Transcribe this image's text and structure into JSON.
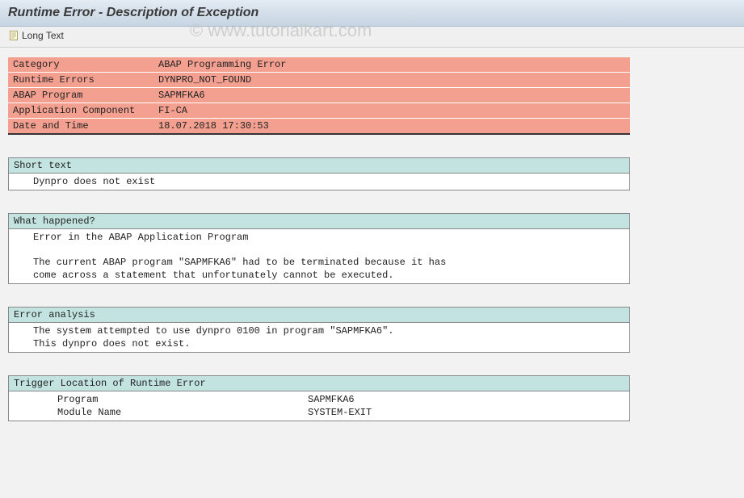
{
  "page_title": "Runtime Error - Description of Exception",
  "toolbar": {
    "long_text_label": "Long Text"
  },
  "info": {
    "rows": [
      {
        "label": "Category",
        "value": "ABAP Programming Error"
      },
      {
        "label": "Runtime Errors",
        "value": "DYNPRO_NOT_FOUND"
      },
      {
        "label": "ABAP Program",
        "value": "SAPMFKA6"
      },
      {
        "label": "Application Component",
        "value": "FI-CA"
      },
      {
        "label": "Date and Time",
        "value": "18.07.2018 17:30:53"
      }
    ]
  },
  "sections": {
    "short_text": {
      "header": "Short text",
      "lines": [
        "Dynpro does not exist"
      ]
    },
    "what_happened": {
      "header": "What happened?",
      "lines": [
        "Error in the ABAP Application Program",
        "",
        "The current ABAP program \"SAPMFKA6\" had to be terminated because it has",
        "come across a statement that unfortunately cannot be executed."
      ]
    },
    "error_analysis": {
      "header": "Error analysis",
      "lines": [
        "The system attempted to use dynpro 0100 in program \"SAPMFKA6\".",
        "This dynpro does not exist."
      ]
    },
    "trigger_location": {
      "header": "Trigger Location of Runtime Error",
      "rows": [
        {
          "label": "Program",
          "value": "SAPMFKA6"
        },
        {
          "label": "Module Name",
          "value": "SYSTEM-EXIT"
        }
      ]
    }
  },
  "watermark": "© www.tutorialkart.com"
}
